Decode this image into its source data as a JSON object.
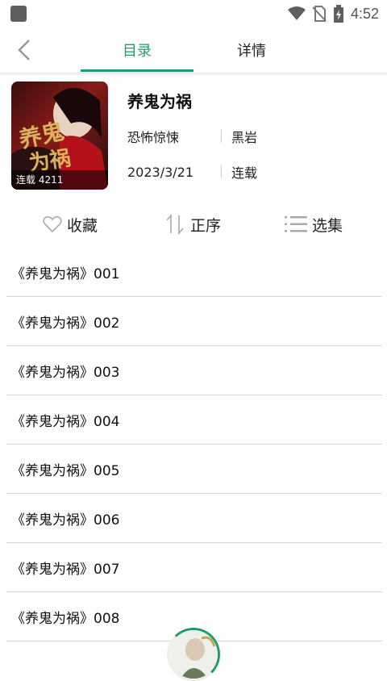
{
  "status_bar": {
    "time": "4:52"
  },
  "nav": {
    "tabs": [
      {
        "label": "目录",
        "active": true
      },
      {
        "label": "详情",
        "active": false
      }
    ]
  },
  "book": {
    "title": "养鬼为祸",
    "genre": "恐怖惊悚",
    "author": "黑岩",
    "date": "2023/3/21",
    "status": "连载",
    "cover_badge": "连载 4211",
    "cover_text": "养鬼为祸"
  },
  "actions": {
    "favorite": "收藏",
    "order": "正序",
    "select": "选集"
  },
  "chapters": [
    "《养鬼为祸》001",
    "《养鬼为祸》002",
    "《养鬼为祸》003",
    "《养鬼为祸》004",
    "《养鬼为祸》005",
    "《养鬼为祸》006",
    "《养鬼为祸》007",
    "《养鬼为祸》008"
  ],
  "colors": {
    "accent": "#1f9d6e",
    "divider": "#d6d6d6"
  }
}
